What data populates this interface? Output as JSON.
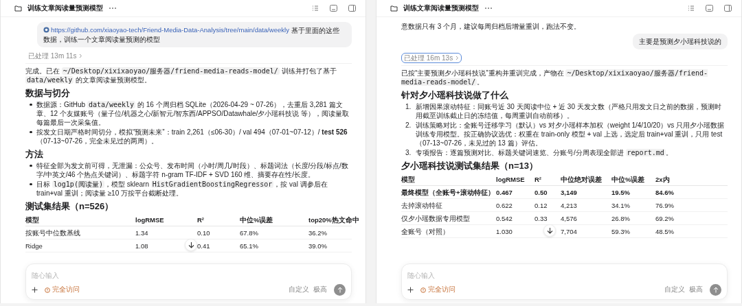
{
  "panels": [
    {
      "title": "训练文章阅读量预测模型",
      "blocks": [
        {
          "kind": "user_message",
          "segments": [
            {
              "kind": "link",
              "text": "https://github.com/xiaoyao-tech/Friend-Media-Data-Analysis/tree/main/data/weekly"
            },
            {
              "kind": "text",
              "text": " 基于里面的这些数据，训练一个文章阅读量预测的模型"
            }
          ]
        },
        {
          "kind": "processed",
          "text": "已处理 13m 11s",
          "focused": false
        },
        {
          "kind": "paragraph",
          "segments": [
            {
              "kind": "text",
              "text": "完成。已在 "
            },
            {
              "kind": "code",
              "text": "~/Desktop/xixixaoyao/服务器/friend-media-reads-model/"
            },
            {
              "kind": "text",
              "text": " 训练并打包了基于 "
            },
            {
              "kind": "code",
              "text": "data/weekly"
            },
            {
              "kind": "text",
              "text": " 的文章阅读量预测模型。"
            }
          ]
        },
        {
          "kind": "heading",
          "text": "数据与切分"
        },
        {
          "kind": "bullets",
          "items": [
            {
              "segments": [
                {
                  "kind": "text",
                  "text": "数据源：GitHub "
                },
                {
                  "kind": "code",
                  "text": "data/weekly"
                },
                {
                  "kind": "text",
                  "text": " 的 16 个周归档 SQLite（2026-04-29 ~ 07-26），去重后 3,281 篇文章、12 个友媒账号（量子位/机器之心/新智元/智东西/APPSO/Datawhale/夕小瑶科技说 等），阅读量取每篇最后一次采集值。"
                }
              ]
            },
            {
              "segments": [
                {
                  "kind": "text",
                  "text": "按发文日期严格时间切分，模拟“预测未来”：train 2,261（≤06-30）/ val 494（07-01~07-12）/ "
                },
                {
                  "kind": "bold",
                  "text": "test 526"
                },
                {
                  "kind": "text",
                  "text": "（07-13~07-26，完全未见过的两周）。"
                }
              ]
            }
          ]
        },
        {
          "kind": "heading",
          "text": "方法"
        },
        {
          "kind": "bullets",
          "items": [
            {
              "segments": [
                {
                  "kind": "text",
                  "text": "特征全部为发文前可得，无泄漏：公众号、发布时间（小时/周几/时段）、标题词法（长度/分段/标点/数字/中英文/46 个热点关键词）、标题字符 n-gram TF-IDF + SVD 160 维、摘要存在性/长度。"
                }
              ]
            },
            {
              "segments": [
                {
                  "kind": "text",
                  "text": "目标 "
                },
                {
                  "kind": "code",
                  "text": "log1p(阅读量)"
                },
                {
                  "kind": "text",
                  "text": "，模型 sklearn "
                },
                {
                  "kind": "code",
                  "text": "HistGradientBoostingRegressor"
                },
                {
                  "kind": "text",
                  "text": "，按 val 调参后在 train+val 重训；阅读量 ≥10 万按平台截断处理。"
                }
              ]
            }
          ]
        },
        {
          "kind": "heading",
          "text": "测试集结果（n=526）"
        },
        {
          "kind": "table",
          "columns": [
            "模型",
            "logRMSE",
            "R²",
            "中位%误差",
            "top20%热文命中"
          ],
          "rows": [
            {
              "bold": false,
              "cells": [
                "按账号中位数基线",
                "1.34",
                "0.10",
                "67.8%",
                "36.2%"
              ]
            },
            {
              "bold": false,
              "cells": [
                "Ridge",
                "1.08",
                "0.41",
                "65.1%",
                "39.0%"
              ]
            }
          ]
        }
      ],
      "composer": {
        "placeholder": "随心输入",
        "access": "完全访问",
        "mode": "自定义",
        "level": "极高"
      }
    },
    {
      "title": "训练文章阅读量预测模型",
      "blocks": [
        {
          "kind": "paragraph",
          "segments": [
            {
              "kind": "text",
              "text": "意数据只有 3 个月，建议每周归档后增量重训，跑法不变。"
            }
          ]
        },
        {
          "kind": "user_message",
          "segments": [
            {
              "kind": "text",
              "text": "主要是预测夕小瑶科技说的"
            }
          ]
        },
        {
          "kind": "processed",
          "text": "已处理 16m 13s",
          "focused": true
        },
        {
          "kind": "paragraph",
          "segments": [
            {
              "kind": "text",
              "text": "已按“主要预测夕小瑶科技说”重构并重训完成，产物在 "
            },
            {
              "kind": "code",
              "text": "~/Desktop/xixixaoyao/服务器/friend-media-reads-model/"
            },
            {
              "kind": "text",
              "text": "。"
            }
          ]
        },
        {
          "kind": "heading",
          "text": "针对夕小瑶科技说做了什么"
        },
        {
          "kind": "numbered",
          "items": [
            {
              "marker": "1.",
              "segments": [
                {
                  "kind": "text",
                  "text": "新增因果滚动特征：同账号近 30 天阅读中位 + 近 30 天发文数（严格只用发文日之前的数据，预测时用截至训练截止日的冻结值，每周重训自动前移）。"
                }
              ]
            },
            {
              "marker": "2.",
              "segments": [
                {
                  "kind": "text",
                  "text": "训练策略对比：全账号迁移学习（默认）vs 对夕小瑶样本加权（weight 1/4/10/20）vs 只用夕小瑶数据训练专用模型。按正确协议选优：权重在 train-only 模型 + val 上选，选定后 train+val 重训，只用 test（07-13~07-26，未见过的 13 篇）评估。"
                }
              ]
            },
            {
              "marker": "3.",
              "segments": [
                {
                  "kind": "text",
                  "text": "专项报告：逐篇预测对比、标题关键词速览、分账号/分周表现全部进 "
                },
                {
                  "kind": "code",
                  "text": "report.md"
                },
                {
                  "kind": "text",
                  "text": "。"
                }
              ]
            }
          ]
        },
        {
          "kind": "heading",
          "text": "夕小瑶科技说测试集结果（n=13）"
        },
        {
          "kind": "table",
          "columns": [
            "模型",
            "logRMSE",
            "R²",
            "中位绝对误差",
            "中位%误差",
            "2x内"
          ],
          "rows": [
            {
              "bold": true,
              "cells": [
                "最终模型（全账号+滚动特征）",
                "0.467",
                "0.50",
                "3,149",
                "19.5%",
                "84.6%"
              ]
            },
            {
              "bold": false,
              "cells": [
                "去掉滚动特征",
                "0.622",
                "0.12",
                "4,213",
                "34.1%",
                "76.9%"
              ]
            },
            {
              "bold": false,
              "cells": [
                "仅夕小瑶数据专用模型",
                "0.542",
                "0.33",
                "4,576",
                "26.8%",
                "69.2%"
              ]
            },
            {
              "bold": false,
              "cells": [
                "全账号（对照）",
                "1.030",
                null,
                "7,704",
                "59.3%",
                "48.5%"
              ]
            }
          ]
        }
      ],
      "composer": {
        "placeholder": "随心输入",
        "access": "完全访问",
        "mode": "自定义",
        "level": "极高"
      }
    }
  ]
}
